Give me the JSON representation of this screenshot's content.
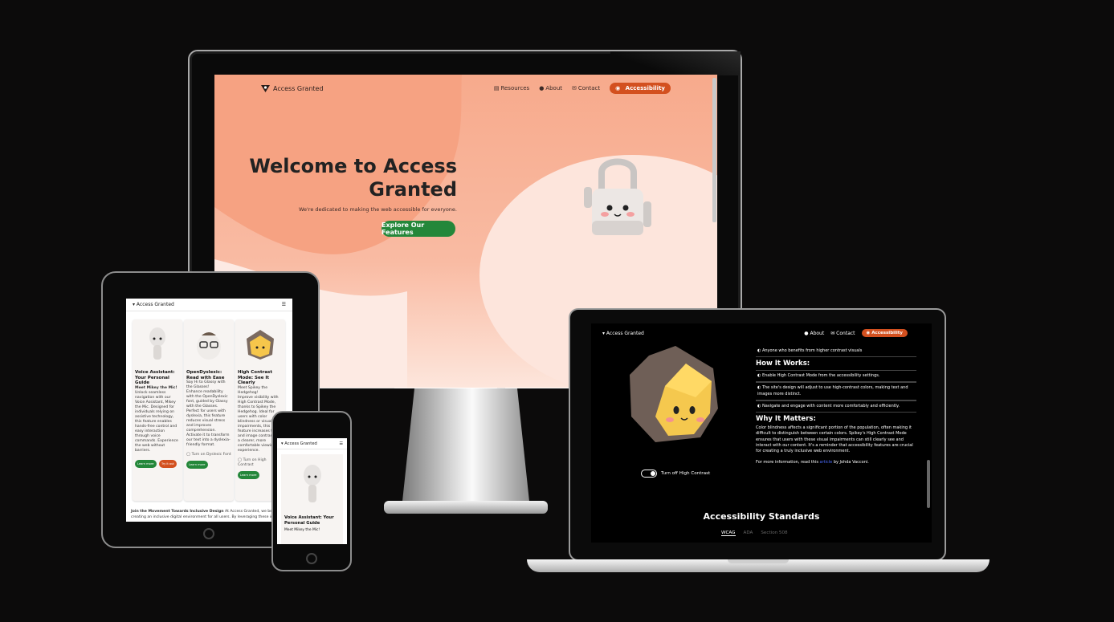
{
  "brand": "Access Granted",
  "desktop": {
    "nav": {
      "resources": "Resources",
      "about": "About",
      "contact": "Contact",
      "accessibility": "Accessibility"
    },
    "hero": {
      "title": "Welcome to Access Granted",
      "subtitle": "We're dedicated to making the web accessible for everyone.",
      "cta": "Explore Our Features"
    }
  },
  "tablet": {
    "cards": [
      {
        "title": "Voice Assistant: Your Personal Guide",
        "lead": "Meet Mikey the Mic!",
        "body": "Unlock seamless navigation with our Voice Assistant, Mikey the Mic. Designed for individuals relying on assistive technology, this feature enables hands-free control and easy interaction through voice commands. Experience the web without barriers.",
        "btn1": "Learn more",
        "btn2": "Try it out"
      },
      {
        "title": "OpenDyslexic: Read with Ease",
        "lead": "Say Hi to Glassy with the Glasses!",
        "body": "Enhance readability with the OpenDyslexic font, guided by Glassy with the Glasses. Perfect for users with dyslexia, this feature reduces visual stress and improves comprehension. Activate it to transform our text into a dyslexia-friendly format.",
        "toggle": "Turn on Dyslexic Font",
        "btn1": "Learn more"
      },
      {
        "title": "High Contrast Mode: See It Clearly",
        "lead": "Meet Spikey the Hedgehog!",
        "body": "Improve visibility with High Contrast Mode, thanks to Spikey the Hedgehog. Ideal for users with color blindness or visual impairments, this feature increases text and image contrast for a clearer, more comfortable viewing experience.",
        "toggle": "Turn on High Contrast",
        "btn1": "Learn more"
      }
    ],
    "footer_bold": "Join the Movement Towards Inclusive Design",
    "footer_text": "At Access Granted, we believe in creating an inclusive digital environment for all users. By leveraging these innovat"
  },
  "phone": {
    "card_title": "Voice Assistant: Your Personal Guide",
    "card_lead": "Meet Mikey the Mic!"
  },
  "laptop": {
    "nav": {
      "about": "About",
      "contact": "Contact",
      "accessibility": "Accessibility"
    },
    "bullet_top": "Anyone who benefits from higher contrast visuals",
    "how_title": "How It Works:",
    "how_items": [
      "Enable High Contrast Mode from the accessibility settings.",
      "The site's design will adjust to use high-contrast colors, making text and images more distinct.",
      "Navigate and engage with content more comfortably and efficiently."
    ],
    "why_title": "Why It Matters:",
    "why_body": "Color blindness affects a significant portion of the population, often making it difficult to distinguish between certain colors. Spikey's High Contrast Mode ensures that users with these visual impairments can still clearly see and interact with our content. It's a reminder that accessibility features are crucial for creating a truly inclusive web environment.",
    "more_prefix": "For more information, read this",
    "more_link": "article",
    "more_suffix": "by Johda Vacconi.",
    "toggle": "Turn off High Contrast",
    "standards_title": "Accessibility Standards",
    "tabs": [
      "WCAG",
      "ADA",
      "Section 508"
    ]
  },
  "colors": {
    "accent": "#d3501f",
    "cta": "#24873a",
    "peach": "#f7aa8c"
  }
}
